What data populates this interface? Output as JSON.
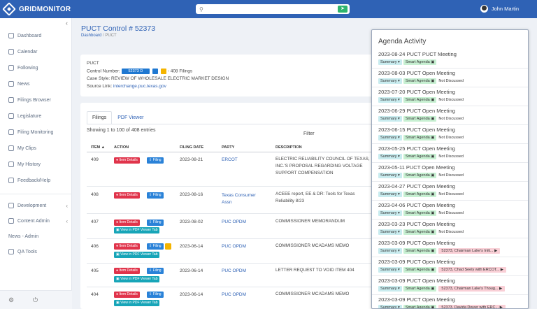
{
  "app": {
    "logo_text": "GRIDMONITOR"
  },
  "search": {
    "placeholder": "",
    "icon": "search-icon",
    "button_icon": "go-icon"
  },
  "user": {
    "name": "John Martin"
  },
  "sidebar": {
    "items": [
      {
        "label": "Dashboard",
        "icon": "dashboard-icon"
      },
      {
        "label": "Calendar",
        "icon": "calendar-icon"
      },
      {
        "label": "Following",
        "icon": "bookmark-icon"
      },
      {
        "label": "News",
        "icon": "news-icon"
      },
      {
        "label": "Filings Browser",
        "icon": "file-icon"
      },
      {
        "label": "Legislature",
        "icon": "gavel-icon"
      },
      {
        "label": "Filing Monitoring",
        "icon": "monitor-icon"
      },
      {
        "label": "My Clips",
        "icon": "clip-icon"
      },
      {
        "label": "My History",
        "icon": "history-icon"
      },
      {
        "label": "Feedback/Help",
        "icon": "help-icon"
      }
    ],
    "groups": [
      {
        "label": "Development",
        "icon": "code-icon"
      },
      {
        "label": "Content Admin",
        "icon": "admin-icon"
      },
      {
        "label": "News - Admin"
      },
      {
        "label": "QA Tools",
        "icon": "qa-icon"
      }
    ],
    "footer": {
      "settings_icon": "gear-icon",
      "power_icon": "power-icon"
    }
  },
  "page": {
    "title": "PUCT Control # 52373",
    "breadcrumb": [
      "Dashboard",
      "PUCT"
    ]
  },
  "info": {
    "agency": "PUCT",
    "control_label": "Control Number:",
    "control_number": "52373",
    "filings_text": "- 408 Filings",
    "case_style": "Case Style: REVIEW OF WHOLESALE ELECTRIC MARKET DESIGN",
    "source_label": "Source Link:",
    "source_link": "interchange.puc.texas.gov"
  },
  "tabs": [
    {
      "label": "Filings"
    },
    {
      "label": "PDF Viewer"
    }
  ],
  "table": {
    "entries_text": "Showing 1 to 100 of 408 entries",
    "filter_label": "Filter",
    "headers": [
      "ITEM",
      "ACTION",
      "FILING DATE",
      "PARTY",
      "DESCRIPTION"
    ],
    "action_labels": {
      "details": "Item Details",
      "filing": "Filing",
      "pdf": "View in PDF Viewer Tab"
    },
    "rows": [
      {
        "item": "409",
        "date": "2023-08-21",
        "party": "ERCOT",
        "description": "ELECTRIC RELIABILITY COUNCIL OF TEXAS, INC.'S PROPOSAL REGARDING VOLTAGE SUPPORT COMPENSATION"
      },
      {
        "item": "408",
        "date": "2023-08-16",
        "party": "Texas Consumer Assn",
        "description": "ACEEE report, EE & DR: Tools for Texas Reliability 8/23"
      },
      {
        "item": "407",
        "date": "2023-08-02",
        "party": "PUC OPDM",
        "description": "COMMISSIONER MEMORANDUM"
      },
      {
        "item": "406",
        "date": "2023-06-14",
        "party": "PUC OPDM",
        "description": "COMMISSIONER MCADAMS MEMO"
      },
      {
        "item": "405",
        "date": "2023-06-14",
        "party": "PUC OPDM",
        "description": "LETTER REQUEST TO VOID ITEM 404"
      },
      {
        "item": "404",
        "date": "2023-06-14",
        "party": "PUC OPDM",
        "description": "COMMISSIONER MCADAMS MEMO"
      }
    ]
  },
  "agenda": {
    "title": "Agenda Activity",
    "summary_label": "Summary",
    "smart_label": "Smart Agenda",
    "items": [
      {
        "title": "2023-08-24 PUCT PUCT Meeting",
        "status": "",
        "note": ""
      },
      {
        "title": "2023-08-03 PUCT Open Meeting",
        "status": "Not Discussed",
        "note": ""
      },
      {
        "title": "2023-07-20 PUCT Open Meeting",
        "status": "Not Discussed",
        "note": ""
      },
      {
        "title": "2023-06-29 PUCT Open Meeting",
        "status": "Not Discussed",
        "note": ""
      },
      {
        "title": "2023-06-15 PUCT Open Meeting",
        "status": "Not Discussed",
        "note": ""
      },
      {
        "title": "2023-05-25 PUCT Open Meeting",
        "status": "Not Discussed",
        "note": ""
      },
      {
        "title": "2023-05-11 PUCT Open Meeting",
        "status": "Not Discussed",
        "note": ""
      },
      {
        "title": "2023-04-27 PUCT Open Meeting",
        "status": "Not Discussed",
        "note": ""
      },
      {
        "title": "2023-04-06 PUCT Open Meeting",
        "status": "Not Discussed",
        "note": ""
      },
      {
        "title": "2023-03-23 PUCT Open Meeting",
        "status": "Not Discussed",
        "note": ""
      },
      {
        "title": "2023-03-09 PUCT Open Meeting",
        "status": "",
        "note": "52373, Chairman Lake's Initi..."
      },
      {
        "title": "2023-03-09 PUCT Open Meeting",
        "status": "",
        "note": "52373, Chad Seely with ERCOT..."
      },
      {
        "title": "2023-03-09 PUCT Open Meeting",
        "status": "",
        "note": "52373, Chairman Lake's Thoug..."
      },
      {
        "title": "2023-03-09 PUCT Open Meeting",
        "status": "",
        "note": "52373, Davida Dwyer with ERC..."
      }
    ]
  },
  "colors": {
    "brand": "#2f62b5",
    "danger": "#e0344b",
    "primary": "#2a82d8",
    "info": "#17a5b8",
    "success": "#2db46d"
  }
}
